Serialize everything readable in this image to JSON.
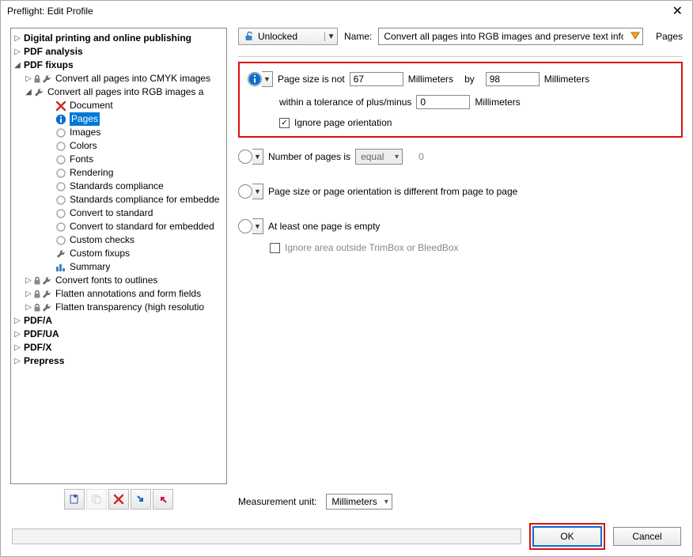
{
  "window": {
    "title": "Preflight: Edit Profile"
  },
  "tree": {
    "groups": {
      "digital": "Digital printing and online publishing",
      "pdf_analysis": "PDF analysis",
      "pdf_fixups": "PDF fixups",
      "pdfa": "PDF/A",
      "pdfua": "PDF/UA",
      "pdfx": "PDF/X",
      "prepress": "Prepress"
    },
    "fixups": {
      "cmyk": "Convert all pages into CMYK images",
      "rgb": "Convert all pages into RGB images a",
      "fonts_outlines": "Convert fonts to outlines",
      "flatten_ann": "Flatten annotations and form fields",
      "flatten_trans": "Flatten transparency (high resolutio"
    },
    "rgb_children": {
      "document": "Document",
      "pages": "Pages",
      "images": "Images",
      "colors": "Colors",
      "fonts": "Fonts",
      "rendering": "Rendering",
      "std_comp": "Standards compliance",
      "std_comp_emb": "Standards compliance for embedde",
      "conv_std": "Convert to standard",
      "conv_std_emb": "Convert to standard for embedded ",
      "custom_checks": "Custom checks",
      "custom_fixups": "Custom fixups",
      "summary": "Summary"
    }
  },
  "top": {
    "lock_label": "Unlocked",
    "name_label": "Name:",
    "name_value": "Convert all pages into RGB images and preserve text informa",
    "crumb": "Pages"
  },
  "panel1": {
    "label_pre": "Page size is not",
    "w": "67",
    "unit1": "Millimeters",
    "by": "by",
    "h": "98",
    "unit2": "Millimeters",
    "tol_label": "within a tolerance of plus/minus",
    "tol": "0",
    "tol_unit": "Millimeters",
    "ignore_label": "Ignore page orientation"
  },
  "row_pages": {
    "label": "Number of pages is",
    "op": "equal",
    "val": "0"
  },
  "row_orient": {
    "label": "Page size or page orientation is different from page to page"
  },
  "row_empty": {
    "label": "At least one page is empty",
    "sub": "Ignore area outside TrimBox or BleedBox"
  },
  "meas": {
    "label": "Measurement unit:",
    "value": "Millimeters"
  },
  "buttons": {
    "ok": "OK",
    "cancel": "Cancel"
  }
}
